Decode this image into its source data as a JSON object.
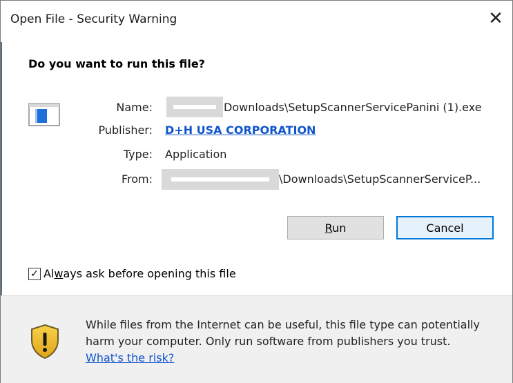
{
  "window": {
    "title": "Open File - Security Warning",
    "close_glyph": "✕"
  },
  "question": "Do you want to run this file?",
  "icons": {
    "file": "application-file-icon",
    "shield": "warning-shield-icon",
    "close": "close-icon"
  },
  "details": {
    "name_label": "Name:",
    "name_value": "Downloads\\SetupScannerServicePanini (1).exe",
    "publisher_label": "Publisher:",
    "publisher_value": "D+H USA CORPORATION",
    "type_label": "Type:",
    "type_value": "Application",
    "from_label": "From:",
    "from_value": "\\Downloads\\SetupScannerServiceP..."
  },
  "buttons": {
    "run": "Run",
    "cancel": "Cancel"
  },
  "checkbox": {
    "label_prefix": "Al",
    "label_underlined": "w",
    "label_suffix": "ays ask before opening this file",
    "checked_glyph": "✓"
  },
  "footer": {
    "message": "While files from the Internet can be useful, this file type can potentially harm your computer. Only run software from publishers you trust.",
    "risk_link": "What's the risk?"
  },
  "colors": {
    "link": "#1155cc",
    "accent": "#0078d7",
    "shield_yellow": "#f2c230"
  }
}
